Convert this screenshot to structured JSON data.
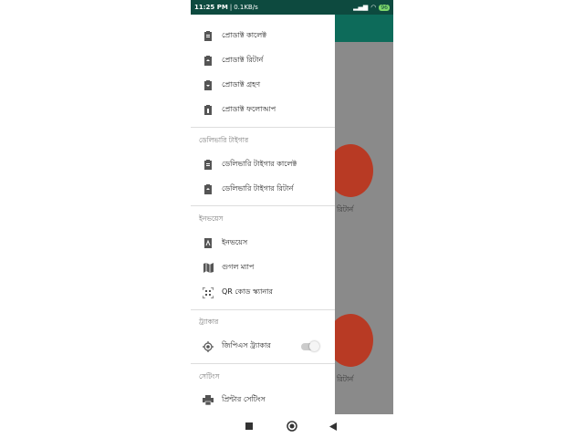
{
  "status_bar": {
    "time": "11:25 PM",
    "speed": "0.1KB/s",
    "battery": "96"
  },
  "background": {
    "item1_label": "রিটার্ন",
    "item2_label": "রিটার্ন"
  },
  "drawer": {
    "items_top": [
      {
        "label": "প্রোডাক্ট কালেক্ট",
        "icon": "clipboard-icon"
      },
      {
        "label": "প্রোডাক্ট রিটার্ন",
        "icon": "clipboard-return-icon"
      },
      {
        "label": "প্রোডাক্ট গ্রহণ",
        "icon": "clipboard-receive-icon"
      },
      {
        "label": "প্রোডাক্ট ফলোআপ",
        "icon": "clipboard-followup-icon"
      }
    ],
    "section_delivery": "ডেলিভারি টাইগার",
    "items_delivery": [
      {
        "label": "ডেলিভারি টাইগার কালেক্ট",
        "icon": "clipboard-icon"
      },
      {
        "label": "ডেলিভারি টাইগার রিটার্ন",
        "icon": "clipboard-return-icon"
      }
    ],
    "section_invoice": "ইনভয়েস",
    "items_invoice": [
      {
        "label": "ইনভয়েস",
        "icon": "pdf-icon"
      },
      {
        "label": "গুগল ম্যাপ",
        "icon": "map-icon"
      },
      {
        "label": "QR কোড স্ক্যানার",
        "icon": "qr-scanner-icon"
      }
    ],
    "section_tracker": "ট্র্যাকার",
    "items_tracker": [
      {
        "label": "জিপিএস ট্র্যাকার",
        "icon": "gps-icon",
        "toggle": "off"
      }
    ],
    "section_settings": "সেটিংস",
    "items_settings": [
      {
        "label": "প্রিন্টার সেটিংস",
        "icon": "printer-icon"
      }
    ]
  },
  "colors": {
    "status_bar": "#0d4a3f",
    "app_bar": "#0d6b5a",
    "logo": "#b83a24"
  }
}
